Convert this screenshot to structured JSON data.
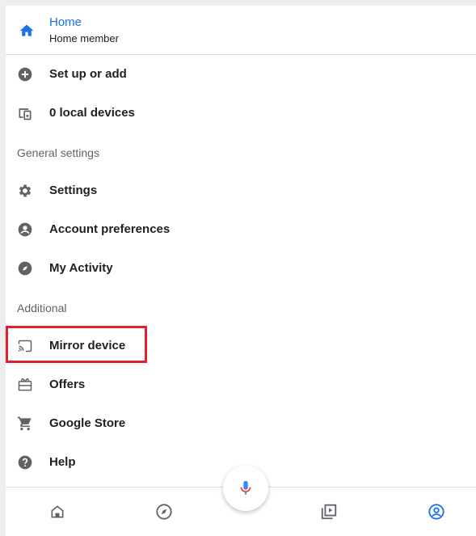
{
  "header": {
    "title": "Home",
    "subtitle": "Home member"
  },
  "menu": {
    "setup": "Set up or add",
    "local_devices": "0 local devices",
    "section_general": "General settings",
    "settings": "Settings",
    "account_prefs": "Account preferences",
    "my_activity": "My Activity",
    "section_additional": "Additional",
    "mirror": "Mirror device",
    "offers": "Offers",
    "store": "Google Store",
    "help": "Help"
  },
  "highlighted_item": "Mirror device",
  "colors": {
    "accent": "#1a73e8",
    "highlight": "#e5202e",
    "icon": "#5f6368"
  },
  "bottom_nav": {
    "active": "account",
    "items": [
      "home",
      "discover",
      "media",
      "account"
    ]
  }
}
